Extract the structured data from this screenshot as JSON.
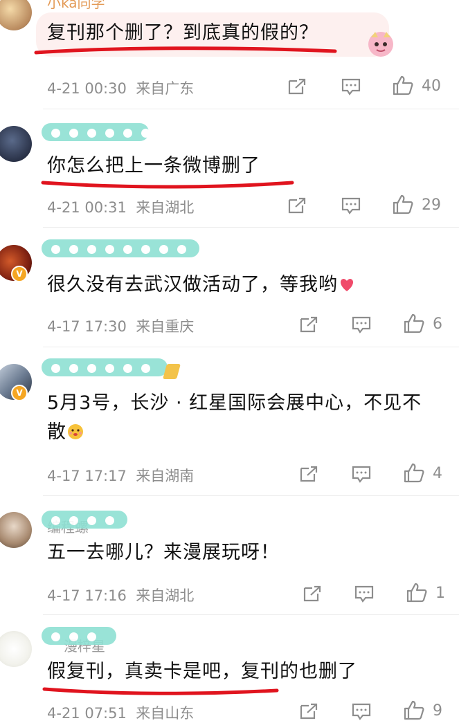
{
  "comments": [
    {
      "username": "小ka同学",
      "text": "复刊那个删了？到底真的假的？",
      "time": "4-21 00:30",
      "location": "来自广东",
      "likes": "40"
    },
    {
      "username": "",
      "text": "你怎么把上一条微博删了",
      "time": "4-21 00:31",
      "location": "来自湖北",
      "likes": "29"
    },
    {
      "username": "",
      "text": "很久没有去武汉做活动了，等我哟",
      "time": "4-17 17:30",
      "location": "来自重庆",
      "likes": "6"
    },
    {
      "username": "",
      "text": "5月3号，长沙 · 红星国际会展中心，不见不散",
      "time": "4-17 17:17",
      "location": "来自湖南",
      "likes": "4"
    },
    {
      "username": "编程螺",
      "text": "五一去哪儿？来漫展玩呀！",
      "time": "4-17 17:16",
      "location": "来自湖北",
      "likes": "1"
    },
    {
      "username": "漫梓星",
      "text": "假复刊，真卖卡是吧，复刊的也删了",
      "time": "4-21 07:51",
      "location": "来自山东",
      "likes": "9"
    }
  ],
  "icons": {
    "repost": "repost-icon",
    "comment": "comment-icon",
    "like": "thumbs-up-icon",
    "verified": "verified-badge-icon"
  },
  "colors": {
    "meta": "#8d8d8d",
    "underline": "#e0141e",
    "name_mask": "#8ee0d3",
    "bubble": "#fdeeee"
  }
}
